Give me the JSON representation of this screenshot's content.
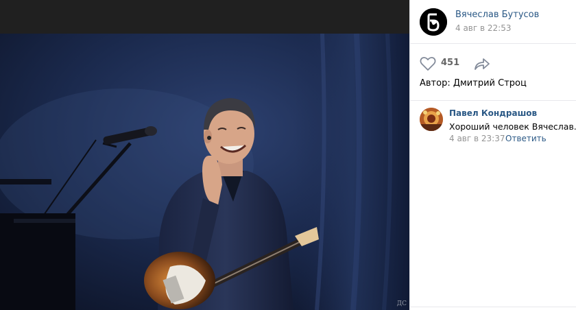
{
  "post": {
    "author_name": "Вячеслав Бутусов",
    "date": "4 авг в 22:53",
    "likes": "451",
    "credit": "Автор: Дмитрий Строц",
    "watermark": "ДС"
  },
  "comment": {
    "author": "Павел Кондрашов",
    "text": "Хороший человек Вячеслав.",
    "date": "4 авг в 23:37",
    "reply_label": "Ответить"
  },
  "icons": {
    "like": "heart-outline-icon",
    "share": "share-arrow-icon"
  },
  "colors": {
    "link": "#2a5885",
    "muted": "#939393",
    "viewer_bg": "#202020"
  }
}
